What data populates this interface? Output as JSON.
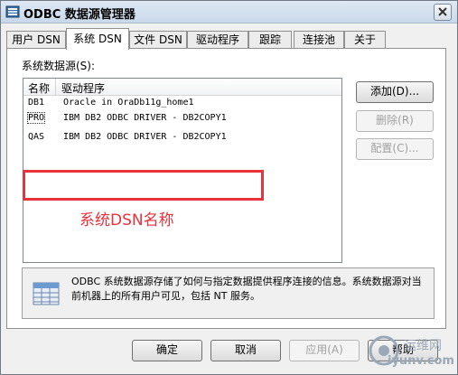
{
  "window": {
    "title": "ODBC 数据源管理器"
  },
  "tabs": [
    {
      "label": "用户 DSN",
      "active": false
    },
    {
      "label": "系统 DSN",
      "active": true
    },
    {
      "label": "文件 DSN",
      "active": false
    },
    {
      "label": "驱动程序",
      "active": false
    },
    {
      "label": "跟踪",
      "active": false
    },
    {
      "label": "连接池",
      "active": false
    },
    {
      "label": "关于",
      "active": false
    }
  ],
  "system_dsn": {
    "group_label": "系统数据源(S):",
    "columns": {
      "name": "名称",
      "driver": "驱动程序"
    },
    "rows": [
      {
        "name": "DB1",
        "driver": "Oracle in OraDb11g_home1"
      },
      {
        "name": "PRO",
        "driver": "IBM DB2 ODBC DRIVER - DB2COPY1"
      },
      {
        "name": "QAS",
        "driver": "IBM DB2 ODBC DRIVER - DB2COPY1"
      }
    ],
    "annotation": "系统DSN名称",
    "annotation_color": "#e8323c",
    "buttons": {
      "add": "添加(D)...",
      "remove": "删除(R)",
      "configure": "配置(C)..."
    },
    "info_text": "ODBC 系统数据源存储了如何与指定数据提供程序连接的信息。系统数据源对当前机器上的所有用户可见，包括 NT 服务。"
  },
  "footer": {
    "ok": "确定",
    "cancel": "取消",
    "apply": "应用(A)",
    "help": "帮助"
  },
  "watermark": {
    "line1": "运维网",
    "line2": "iyunv.com"
  }
}
